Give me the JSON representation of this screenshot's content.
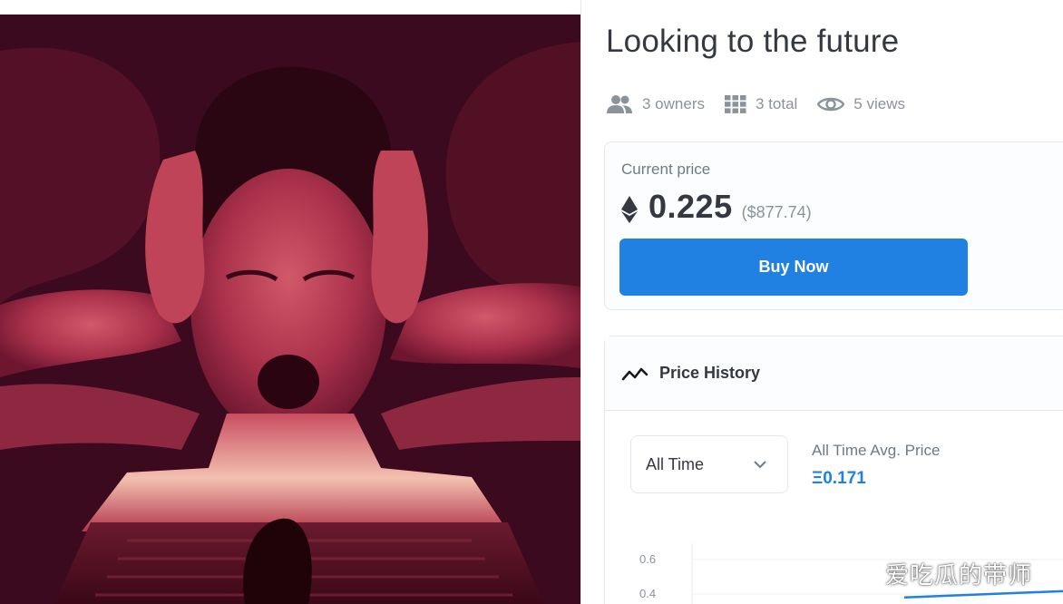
{
  "artwork": {
    "alt": "Looking to the future",
    "tint": "#8c2236"
  },
  "item": {
    "title": "Looking to the future"
  },
  "stats": {
    "owners": {
      "icon": "people-icon",
      "label": "3 owners"
    },
    "total": {
      "icon": "grid-icon",
      "label": "3 total"
    },
    "views": {
      "icon": "eye-icon",
      "label": "5 views"
    }
  },
  "price": {
    "label": "Current price",
    "currency_icon": "ethereum-icon",
    "value": "0.225",
    "usd": "($877.74)",
    "buy_label": "Buy Now"
  },
  "history": {
    "icon": "trend-line-icon",
    "title": "Price History",
    "range": "All Time",
    "avg_label": "All Time Avg. Price",
    "avg_value": "Ξ0.171"
  },
  "chart_data": {
    "type": "line",
    "y_ticks": [
      "0.6",
      "0.4"
    ],
    "series": [
      {
        "values": [
          0.38,
          0.4,
          0.42
        ]
      }
    ]
  },
  "colors": {
    "accent": "#2081e2",
    "text": "#353840",
    "muted": "#8a939b"
  },
  "watermark": "爱吃瓜的带师"
}
